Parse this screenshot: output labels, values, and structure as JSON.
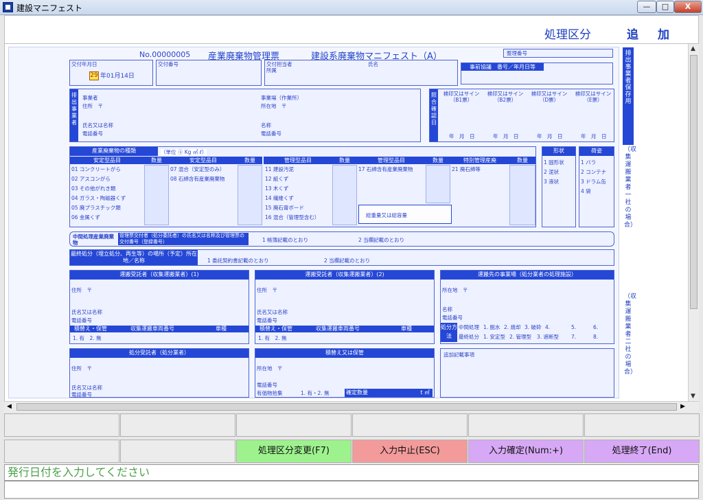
{
  "window": {
    "title": "建設マニフェスト",
    "minimize": "—",
    "maximize": "□",
    "close": "X"
  },
  "topbar": {
    "mode_label": "処理区分",
    "mode_value": "追加"
  },
  "manifest": {
    "number": "No.00000005",
    "title_a": "産業廃棄物管理票",
    "title_b": "建設系廃棄物マニフェスト（A）",
    "seiri_bango": "整理番号",
    "issue_date_label": "交付年月日",
    "issue_era_year": "29",
    "issue_date_rest": "年01月14日",
    "issue_no_label": "交付番号",
    "issuer_staff_label": "交付担当者",
    "affiliation_label": "所属",
    "name_label": "氏名",
    "prior_consult": "事前協議　番号／年月日等",
    "haishutsu_vertical": "排出事業者",
    "jigyosha": "事業者",
    "jusho": "住所　〒",
    "shimei_meisho": "氏名又は名称",
    "denwa": "電話番号",
    "jigyoba": "事業場（作業所）",
    "shozaichi": "所在地　〒",
    "meisho": "名称",
    "denwa2": "電話番号",
    "shogo_vertical": "照合確認日",
    "stamp_cols": [
      "検印又はサイン（B1票）",
      "検印又はサイン（B2票）",
      "検印又はサイン（D票）",
      "検印又はサイン（E票）"
    ],
    "ymd": "年　月　日",
    "right_vertical_1": "排出事業者保存用",
    "right_vertical_2": "（収集運搬業者一社の場合）",
    "right_vertical_3": "（収集運搬業者二社の場合）",
    "waste_header": "産業廃棄物の種類",
    "unit_label": "（単位 ㋣ Kg ㎥ ℓ）",
    "col_antei": "安定型品目",
    "col_suryo": "数量",
    "col_kanri": "管理型品目",
    "col_tokubetsu": "特別管理産廃",
    "antei_items_1": [
      "01 コンクリートがら",
      "02 アスコンがら",
      "03 その他がれき類",
      "04 ガラス・陶磁器くず",
      "05 廃プラスチック類",
      "06 金属くず"
    ],
    "antei_items_2": [
      "07 混合（安定型のみ）",
      "08 石綿含有産業廃棄物"
    ],
    "kanri_items_1": [
      "11 建設汚泥",
      "12 紙くず",
      "13 木くず",
      "14 繊維くず",
      "15 廃石膏ボード",
      "16 混合（管理型含む）"
    ],
    "kanri_items_2": [
      "17 石綿含有産業廃棄物"
    ],
    "tokubetsu_items": [
      "21 廃石綿等"
    ],
    "total_label": "総重量又は総容量",
    "keijo_header": "形状",
    "keijo_items": [
      "1 固形状",
      "2 泥状",
      "3 液状"
    ],
    "nisugata_header": "荷姿",
    "nisugata_items": [
      "1 バラ",
      "2 コンテナ",
      "3 ドラム缶",
      "4 袋"
    ],
    "chukan_label": "中間処理産業廃棄物",
    "chukan_desc": "管理票交付者（処分委託者）の氏名又は名称及び管理票の交付番号（登録番号）",
    "chukan_opt1": "1 帳簿記載のとおり",
    "chukan_opt2": "2 当欄記載のとおり",
    "saishu_label": "最終処分（埋立処分、再生等）の場所（予定）所在地／名称",
    "saishu_opt1": "1 委託契約書記載のとおり",
    "saishu_opt2": "2 当欄記載のとおり",
    "unpan1": "運搬受託者（収集運搬業者）(1)",
    "unpan2": "運搬受託者（収集運搬業者）(2)",
    "unpansaki": "運搬先の事業場（処分業者の処理施設）",
    "tsumikae": "積替え・保管",
    "sharyo_no": "収集運搬車両番号",
    "sharyo": "車種",
    "ari_nashi": "1. 有　2. 無",
    "shobun_hoho": "処分方法",
    "chukan_shori": "中間処理",
    "saishu_shobun": "最終処分",
    "hoho_1": [
      "1. 脱水",
      "2. 焼却",
      "3. 破砕",
      "4.",
      "5.",
      "6."
    ],
    "hoho_2": [
      "1. 安定型",
      "2. 管理型",
      "3. 遮断型",
      "7.",
      "8."
    ],
    "shobun_jutaku": "処分受託者（処分業者）",
    "tsumikae_hokan": "積替え又は保管",
    "yuka": "有価物拾集",
    "yuka_opt": "1. 有・2. 無",
    "kakutei_suryo": "確定数量",
    "unit_tm": "t ㎥",
    "tsuika": "追加記載事項"
  },
  "fkeys": {
    "row1": [
      "",
      "",
      "",
      "",
      "",
      ""
    ],
    "row2": [
      "",
      "",
      "処理区分変更(F7)",
      "入力中止(ESC)",
      "入力確定(Num:+)",
      "処理終了(End)"
    ],
    "colors": [
      "#ececec",
      "#ececec",
      "#9ef28e",
      "#f39a9a",
      "#d7a8f5",
      "#d7a8f5"
    ]
  },
  "message": {
    "line1": "発行日付を入力してください",
    "line2": ""
  }
}
